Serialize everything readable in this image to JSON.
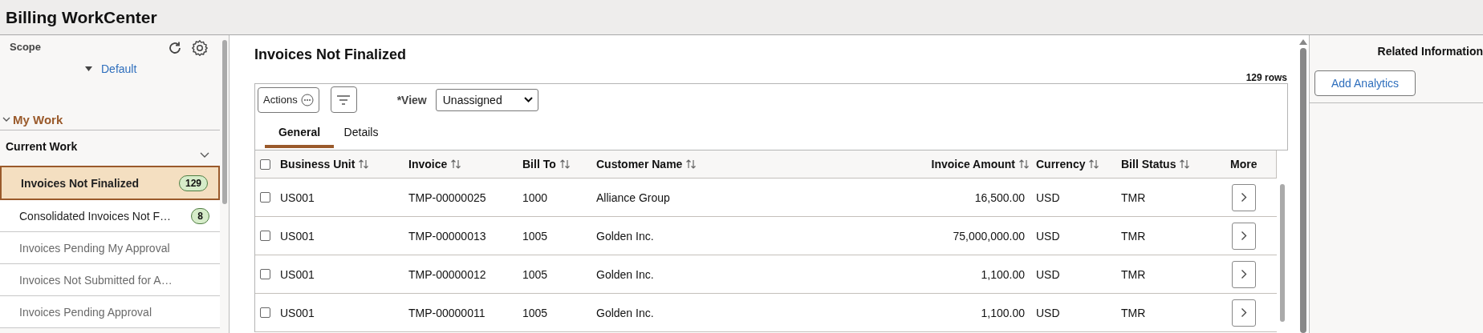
{
  "app_title": "Billing WorkCenter",
  "sidebar": {
    "scope_label": "Scope",
    "scope_value": "Default",
    "section": {
      "label": "My Work",
      "expanded": true
    },
    "group": {
      "label": "Current Work",
      "expanded": true
    },
    "items": [
      {
        "label": "Invoices Not Finalized",
        "count": "129",
        "selected": true,
        "disabled": false
      },
      {
        "label": "Consolidated Invoices Not F…",
        "count": "8",
        "selected": false,
        "disabled": false
      },
      {
        "label": "Invoices Pending My Approval",
        "selected": false,
        "disabled": true
      },
      {
        "label": "Invoices Not Submitted for A…",
        "selected": false,
        "disabled": true
      },
      {
        "label": "Invoices Pending Approval",
        "selected": false,
        "disabled": true
      }
    ]
  },
  "main": {
    "title": "Invoices Not Finalized",
    "row_count": "129 rows",
    "toolbar": {
      "actions_label": "Actions",
      "view_label": "*View",
      "view_value": "Unassigned"
    },
    "tabs": [
      {
        "label": "General",
        "selected": true
      },
      {
        "label": "Details",
        "selected": false
      }
    ],
    "table": {
      "select_all_checked": false,
      "columns": [
        {
          "label": "Business Unit",
          "sortable": true
        },
        {
          "label": "Invoice",
          "sortable": true
        },
        {
          "label": "Bill To",
          "sortable": true
        },
        {
          "label": "Customer Name",
          "sortable": true
        },
        {
          "label": "Invoice Amount",
          "sortable": true
        },
        {
          "label": "Currency",
          "sortable": true
        },
        {
          "label": "Bill Status",
          "sortable": true
        },
        {
          "label": "More",
          "sortable": false
        }
      ],
      "rows": [
        {
          "checked": false,
          "cells": [
            "US001",
            "TMP-00000025",
            "1000",
            "Alliance Group",
            "16,500.00",
            "USD",
            "TMR"
          ]
        },
        {
          "checked": false,
          "cells": [
            "US001",
            "TMP-00000013",
            "1005",
            "Golden Inc.",
            "75,000,000.00",
            "USD",
            "TMR"
          ]
        },
        {
          "checked": false,
          "cells": [
            "US001",
            "TMP-00000012",
            "1005",
            "Golden Inc.",
            "1,100.00",
            "USD",
            "TMR"
          ]
        },
        {
          "checked": false,
          "cells": [
            "US001",
            "TMP-00000011",
            "1005",
            "Golden Inc.",
            "1,100.00",
            "USD",
            "TMR"
          ]
        }
      ]
    }
  },
  "related": {
    "title": "Related Information",
    "button_label": "Add Analytics"
  }
}
